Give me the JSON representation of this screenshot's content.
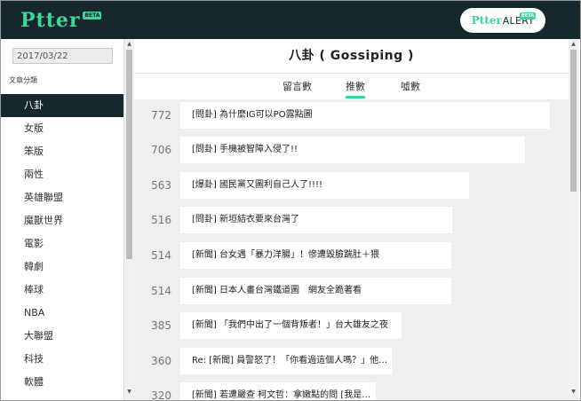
{
  "header": {
    "logo": "Ptter",
    "logo_beta": "BETA",
    "alert_logo": "Ptter",
    "alert_text": "ALERT",
    "alert_beta": "BETA"
  },
  "sidebar": {
    "date_value": "2017/03/22",
    "category_label": "文章分類",
    "items": [
      {
        "label": "八卦",
        "active": true
      },
      {
        "label": "女版"
      },
      {
        "label": "笨版"
      },
      {
        "label": "兩性"
      },
      {
        "label": "英雄聯盟"
      },
      {
        "label": "魔獸世界"
      },
      {
        "label": "電影"
      },
      {
        "label": "韓劇"
      },
      {
        "label": "棒球"
      },
      {
        "label": "NBA"
      },
      {
        "label": "大聯盟"
      },
      {
        "label": "科技"
      },
      {
        "label": "軟體"
      }
    ]
  },
  "board": {
    "title": "八卦 ( Gossiping )"
  },
  "tabs": [
    {
      "label": "留言數"
    },
    {
      "label": "推數",
      "active": true
    },
    {
      "label": "噓數"
    }
  ],
  "posts": [
    {
      "count": "772",
      "title": "[問卦] 為什麼IG可以PO露點圖"
    },
    {
      "count": "706",
      "title": "[問卦] 手機被智障入侵了!!"
    },
    {
      "count": "563",
      "title": "[爆卦] 國民黨又圖利自己人了!!!!"
    },
    {
      "count": "516",
      "title": "[問卦] 新垣結衣要來台灣了"
    },
    {
      "count": "514",
      "title": "[新聞] 台女遇「暴力洋腸」！慘遭毀臉踹肚＋猥"
    },
    {
      "count": "514",
      "title": "[新聞] 日本人畫台灣鐵道圖　網友全跪著看"
    },
    {
      "count": "385",
      "title": "[新聞] 「我們中出了一個背叛者！」台大雄友之夜"
    },
    {
      "count": "360",
      "title": "Re: [新聞] 員警怒了！「你看過這個人嗎？」他…"
    },
    {
      "count": "320",
      "title": "[新聞] 若遭嚴查 柯文哲：拿嫩點的問 [我是…"
    }
  ],
  "scroll": {
    "up_arrow": "▲",
    "down_arrow": "▼"
  }
}
